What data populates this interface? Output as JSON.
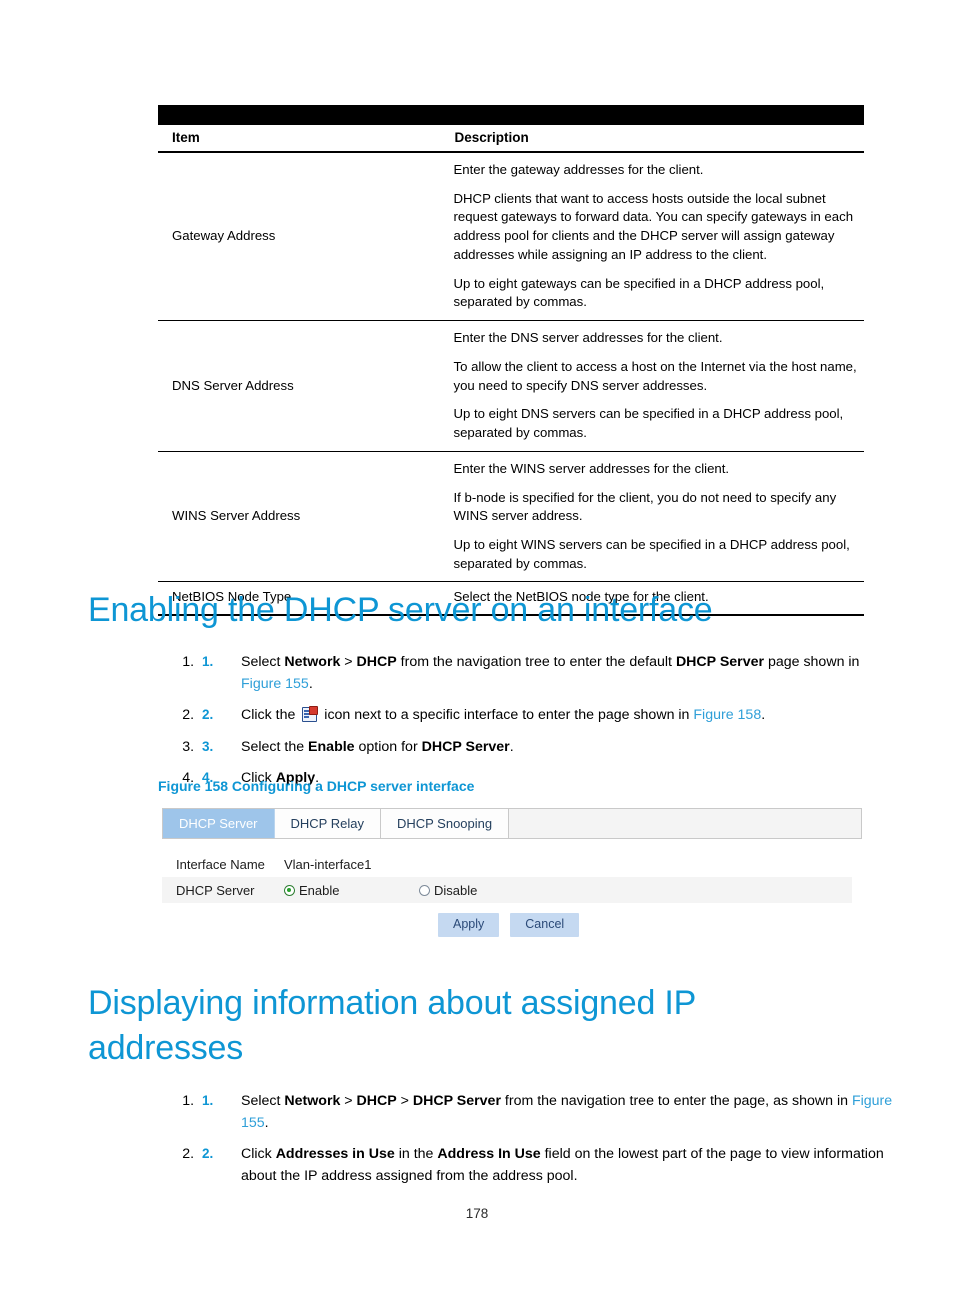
{
  "table": {
    "headers": [
      "Item",
      "Description"
    ],
    "rows": [
      {
        "item": "Gateway Address",
        "paragraphs": [
          "Enter the gateway addresses for the client.",
          "DHCP clients that want to access hosts outside the local subnet request gateways to forward data. You can specify gateways in each address pool for clients and the DHCP server will assign gateway addresses while assigning an IP address to the client.",
          "Up to eight gateways can be specified in a DHCP address pool, separated by commas."
        ]
      },
      {
        "item": "DNS Server Address",
        "paragraphs": [
          "Enter the DNS server addresses for the client.",
          "To allow the client to access a host on the Internet via the host name, you need to specify DNS server addresses.",
          "Up to eight DNS servers can be specified in a DHCP address pool, separated by commas."
        ]
      },
      {
        "item": "WINS Server Address",
        "paragraphs": [
          "Enter the WINS server addresses for the client.",
          "If b-node is specified for the client, you do not need to specify any WINS server address.",
          "Up to eight WINS servers can be specified in a DHCP address pool, separated by commas."
        ]
      },
      {
        "item": "NetBIOS Node Type",
        "paragraphs": [
          "Select the NetBIOS node type for the client."
        ]
      }
    ]
  },
  "section_enabling": {
    "heading": "Enabling the DHCP server on an interface",
    "steps": [
      {
        "num": "1.",
        "parts": [
          {
            "t": "Select ",
            "s": "plain"
          },
          {
            "t": "Network",
            "s": "bold"
          },
          {
            "t": " > ",
            "s": "plain"
          },
          {
            "t": "DHCP",
            "s": "bold"
          },
          {
            "t": " from the navigation tree to enter the default ",
            "s": "plain"
          },
          {
            "t": "DHCP Server",
            "s": "bold"
          },
          {
            "t": " page shown in ",
            "s": "plain"
          },
          {
            "t": "Figure 155",
            "s": "link"
          },
          {
            "t": ".",
            "s": "plain"
          }
        ]
      },
      {
        "num": "2.",
        "parts": [
          {
            "t": "Click the ",
            "s": "plain"
          },
          {
            "t": "",
            "s": "icon"
          },
          {
            "t": " icon next to a specific interface to enter the page shown in ",
            "s": "plain"
          },
          {
            "t": "Figure 158",
            "s": "link"
          },
          {
            "t": ".",
            "s": "plain"
          }
        ]
      },
      {
        "num": "3.",
        "parts": [
          {
            "t": "Select the ",
            "s": "plain"
          },
          {
            "t": "Enable",
            "s": "bold"
          },
          {
            "t": " option for ",
            "s": "plain"
          },
          {
            "t": "DHCP Server",
            "s": "bold"
          },
          {
            "t": ".",
            "s": "plain"
          }
        ]
      },
      {
        "num": "4.",
        "parts": [
          {
            "t": "Click ",
            "s": "plain"
          },
          {
            "t": "Apply",
            "s": "bold"
          },
          {
            "t": ".",
            "s": "plain"
          }
        ]
      }
    ]
  },
  "figure_158": {
    "caption": "Figure 158 Configuring a DHCP server interface",
    "tabs": [
      {
        "label": "DHCP Server",
        "active": true
      },
      {
        "label": "DHCP Relay",
        "active": false
      },
      {
        "label": "DHCP Snooping",
        "active": false
      }
    ],
    "interface_name_label": "Interface Name",
    "interface_name_value": "Vlan-interface1",
    "dhcp_server_label": "DHCP Server",
    "radio_enable_label": "Enable",
    "radio_disable_label": "Disable",
    "radio_selected": "Enable",
    "apply_label": "Apply",
    "cancel_label": "Cancel"
  },
  "section_displaying": {
    "heading": "Displaying information about assigned IP addresses",
    "steps": [
      {
        "num": "1.",
        "parts": [
          {
            "t": "Select ",
            "s": "plain"
          },
          {
            "t": "Network",
            "s": "bold"
          },
          {
            "t": " > ",
            "s": "plain"
          },
          {
            "t": "DHCP",
            "s": "bold"
          },
          {
            "t": " > ",
            "s": "plain"
          },
          {
            "t": "DHCP Server",
            "s": "bold"
          },
          {
            "t": " from the navigation tree to enter the page, as shown in ",
            "s": "plain"
          },
          {
            "t": "Figure 155",
            "s": "link"
          },
          {
            "t": ".",
            "s": "plain"
          }
        ]
      },
      {
        "num": "2.",
        "parts": [
          {
            "t": "Click ",
            "s": "plain"
          },
          {
            "t": "Addresses in Use",
            "s": "bold"
          },
          {
            "t": " in the ",
            "s": "plain"
          },
          {
            "t": "Address In Use",
            "s": "bold"
          },
          {
            "t": " field on the lowest part of the page to view information about the IP address assigned from the address pool.",
            "s": "plain"
          }
        ]
      }
    ]
  },
  "footer": {
    "page_number": "178"
  },
  "colors": {
    "heading": "#0e96d4",
    "link": "#2f9fd8",
    "tab_active_bg": "#9ec5ea",
    "button_bg": "#c5d9f1",
    "button_text": "#2b4a78",
    "radio_selected": "#27a02c"
  }
}
